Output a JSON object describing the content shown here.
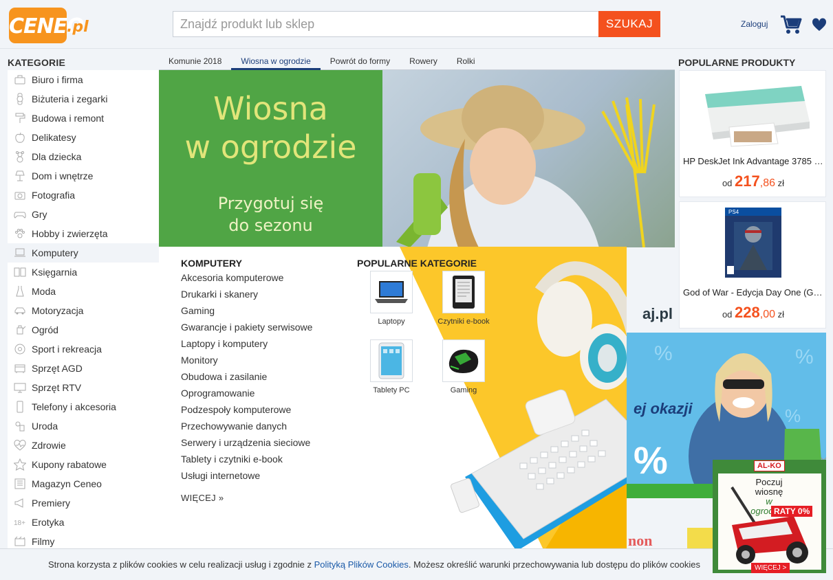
{
  "header": {
    "logo_text": "CENEO",
    "logo_suffix": ".pl",
    "search_placeholder": "Znajdź produkt lub sklep",
    "search_button": "SZUKAJ",
    "login": "Zaloguj"
  },
  "categories": {
    "title": "KATEGORIE",
    "items": [
      {
        "label": "Biuro i firma",
        "icon": "briefcase-icon"
      },
      {
        "label": "Biżuteria i zegarki",
        "icon": "watch-icon"
      },
      {
        "label": "Budowa i remont",
        "icon": "paint-roller-icon"
      },
      {
        "label": "Delikatesy",
        "icon": "apple-icon"
      },
      {
        "label": "Dla dziecka",
        "icon": "teddy-bear-icon"
      },
      {
        "label": "Dom i wnętrze",
        "icon": "lamp-icon"
      },
      {
        "label": "Fotografia",
        "icon": "camera-icon"
      },
      {
        "label": "Gry",
        "icon": "gamepad-icon"
      },
      {
        "label": "Hobby i zwierzęta",
        "icon": "paw-icon"
      },
      {
        "label": "Komputery",
        "icon": "laptop-icon"
      },
      {
        "label": "Księgarnia",
        "icon": "book-icon"
      },
      {
        "label": "Moda",
        "icon": "dress-icon"
      },
      {
        "label": "Motoryzacja",
        "icon": "car-icon"
      },
      {
        "label": "Ogród",
        "icon": "watering-can-icon"
      },
      {
        "label": "Sport i rekreacja",
        "icon": "ball-icon"
      },
      {
        "label": "Sprzęt AGD",
        "icon": "appliance-icon"
      },
      {
        "label": "Sprzęt RTV",
        "icon": "tv-icon"
      },
      {
        "label": "Telefony i akcesoria",
        "icon": "phone-icon"
      },
      {
        "label": "Uroda",
        "icon": "cosmetics-icon"
      },
      {
        "label": "Zdrowie",
        "icon": "heartbeat-icon"
      },
      {
        "label": "Kupony rabatowe",
        "icon": "star-icon"
      },
      {
        "label": "Magazyn Ceneo",
        "icon": "newspaper-icon"
      },
      {
        "label": "Premiery",
        "icon": "megaphone-icon"
      },
      {
        "label": "Erotyka",
        "icon": "18plus-icon"
      },
      {
        "label": "Filmy",
        "icon": "film-icon"
      }
    ]
  },
  "tabs": [
    {
      "label": "Komunie 2018",
      "active": false
    },
    {
      "label": "Wiosna w ogrodzie",
      "active": true
    },
    {
      "label": "Powrót do formy",
      "active": false
    },
    {
      "label": "Rowery",
      "active": false
    },
    {
      "label": "Rolki",
      "active": false
    }
  ],
  "hero": {
    "headline_1": "Wiosna",
    "headline_2": "w ogrodzie",
    "sub_1": "Przygotuj się",
    "sub_2": "do sezonu",
    "watermark": "aj.pl"
  },
  "popular_products": {
    "title": "POPULARNE PRODUKTY",
    "items": [
      {
        "name": "HP DeskJet Ink Advantage 3785 (T8W48C)",
        "prefix": "od",
        "price_int": "217",
        "price_dec": ",86",
        "currency": "zł"
      },
      {
        "name": "God of War - Edycja Day One (Gra PS4)",
        "prefix": "od",
        "price_int": "228",
        "price_dec": ",00",
        "currency": "zł"
      }
    ]
  },
  "banner2": {
    "text_1": "ej okazji",
    "text_2": "%"
  },
  "mega_menu": {
    "title": "KOMPUTERY",
    "links": [
      "Akcesoria komputerowe",
      "Drukarki i skanery",
      "Gaming",
      "Gwarancje i pakiety serwisowe",
      "Laptopy i komputery",
      "Monitory",
      "Obudowa i zasilanie",
      "Oprogramowanie",
      "Podzespoły komputerowe",
      "Przechowywanie danych",
      "Serwery i urządzenia sieciowe",
      "Tablety i czytniki e-book",
      "Usługi internetowe"
    ],
    "more": "WIĘCEJ »",
    "popular_title": "POPULARNE KATEGORIE",
    "popular": [
      {
        "label": "Laptopy"
      },
      {
        "label": "Czytniki e-book"
      },
      {
        "label": "Tablety PC"
      },
      {
        "label": "Gaming"
      }
    ]
  },
  "cookie": {
    "text_before": "Strona korzysta z plików cookies w celu realizacji usług i zgodnie z ",
    "link": "Polityką Plików Cookies",
    "text_after": ". Możesz określić warunki przechowywania lub dostępu do plików cookies"
  },
  "ad": {
    "brand": "AL-KO",
    "slogan_1": "Poczuj wiosnę",
    "slogan_2": "w ogrodzie!",
    "raty": "RATY 0%",
    "more": "WIĘCEJ >",
    "close": "×"
  },
  "brands": {
    "label_1": "non"
  },
  "colors": {
    "accent": "#f4511e",
    "brand_orange": "#f7941e",
    "nav_blue": "#1b3d7a",
    "bg": "#f1f4f8"
  }
}
